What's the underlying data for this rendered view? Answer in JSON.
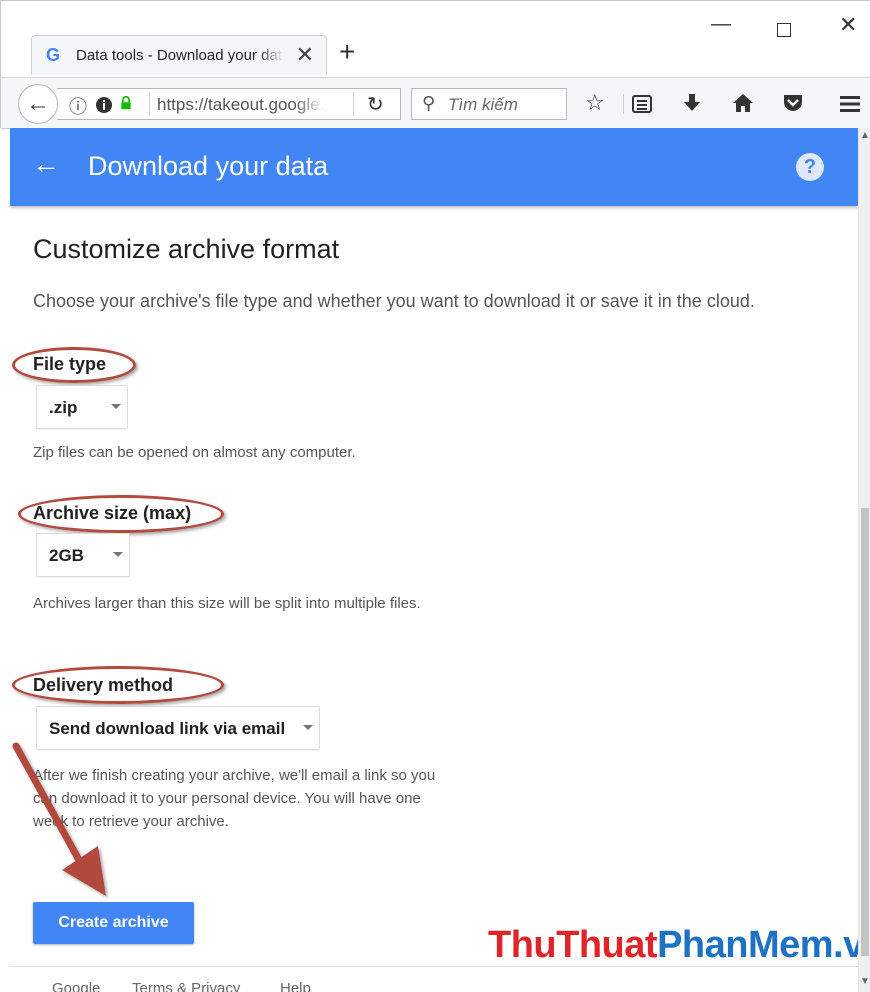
{
  "browser": {
    "tab_title": "Data tools - Download your data",
    "new_tab": "+",
    "url": "https://takeout.google.com",
    "search_placeholder": "Tìm kiếm"
  },
  "app": {
    "title": "Download your data",
    "help": "?"
  },
  "content": {
    "heading": "Customize archive format",
    "subheading": "Choose your archive's file type and whether you want to download it or save it in the cloud.",
    "file_type": {
      "label": "File type",
      "value": ".zip",
      "help": "Zip files can be opened on almost any computer."
    },
    "archive_size": {
      "label": "Archive size (max)",
      "value": "2GB",
      "help": "Archives larger than this size will be split into multiple files."
    },
    "delivery": {
      "label": "Delivery method",
      "value": "Send download link via email",
      "help": "After we finish creating your archive, we'll email a link so you can download it to your personal device. You will have one week to retrieve your archive."
    },
    "create_button": "Create archive"
  },
  "watermark": {
    "part1": "ThuThuat",
    "part2": "PhanMem.vn"
  },
  "footer": {
    "links": [
      "Google",
      "Terms & Privacy",
      "Help"
    ]
  },
  "colors": {
    "primary": "#4285f4",
    "annotation": "#b24a3d",
    "watermark_red": "#e0252a",
    "watermark_blue": "#1d72c4"
  }
}
